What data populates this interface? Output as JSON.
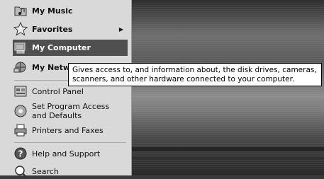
{
  "start_menu": {
    "items": [
      {
        "label": "My Music",
        "icon": "music-folder-icon"
      },
      {
        "label": "Favorites",
        "icon": "star-icon"
      },
      {
        "label": "My Computer",
        "icon": "computer-icon"
      },
      {
        "label": "My Network Places",
        "icon": "network-icon"
      },
      {
        "label": "Control Panel",
        "icon": "control-panel-icon"
      },
      {
        "label": "Set Program Access and Defaults",
        "icon": "program-access-icon"
      },
      {
        "label": "Printers and Faxes",
        "icon": "printer-icon"
      },
      {
        "label": "Help and Support",
        "icon": "help-icon"
      },
      {
        "label": "Search",
        "icon": "search-icon"
      }
    ],
    "selected": "My Computer"
  },
  "tooltip": {
    "text": "Gives access to, and information about, the disk drives, cameras, scanners, and other hardware connected to your computer."
  },
  "colors": {
    "menu_bg": "#d9d9d9",
    "selected_bg": "#4f4f4f",
    "tooltip_bg": "#ffffff"
  }
}
